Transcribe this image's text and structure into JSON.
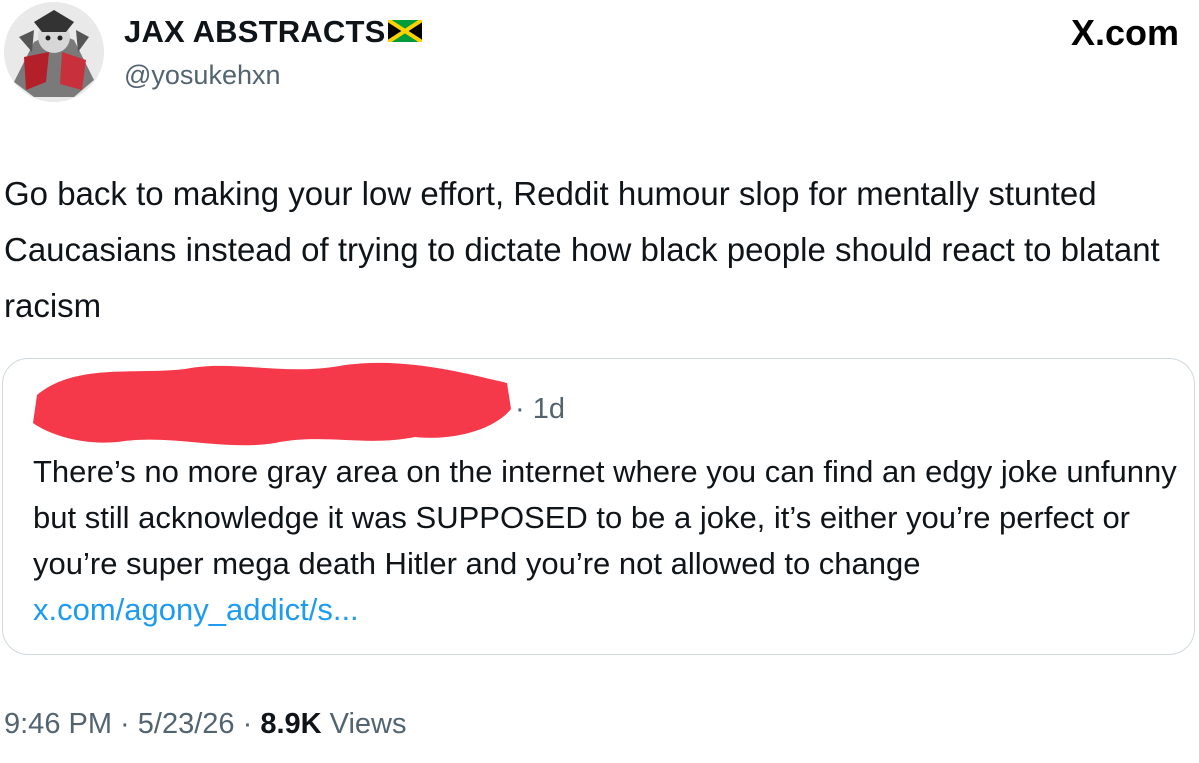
{
  "author": {
    "display_name": "JAX ABSTRACTS",
    "flag_icon": "jamaica-flag-icon",
    "handle": "@yosukehxn"
  },
  "watermark": "X.com",
  "tweet": {
    "text": "Go back to making your low effort, Reddit humour slop for mentally stunted Caucasians instead of trying to dictate how black people should react to blatant racism"
  },
  "quote": {
    "author_redacted": true,
    "time": "· 1d",
    "text": "There’s no more gray area on the internet where you can find an edgy joke unfunny but still acknowledge it was SUPPOSED to be a joke, it’s either you’re perfect or you’re super mega death Hitler and you’re not allowed to change ",
    "link": "x.com/agony_addict/s..."
  },
  "meta": {
    "time": "9:46 PM",
    "sep1": " · ",
    "date": "5/23/26",
    "sep2": " · ",
    "views_count": "8.9K",
    "views_label": " Views"
  },
  "colors": {
    "text": "#0f1419",
    "secondary": "#536471",
    "link": "#1d9bf0",
    "border": "#cfd9de",
    "redaction": "#f5394a"
  }
}
